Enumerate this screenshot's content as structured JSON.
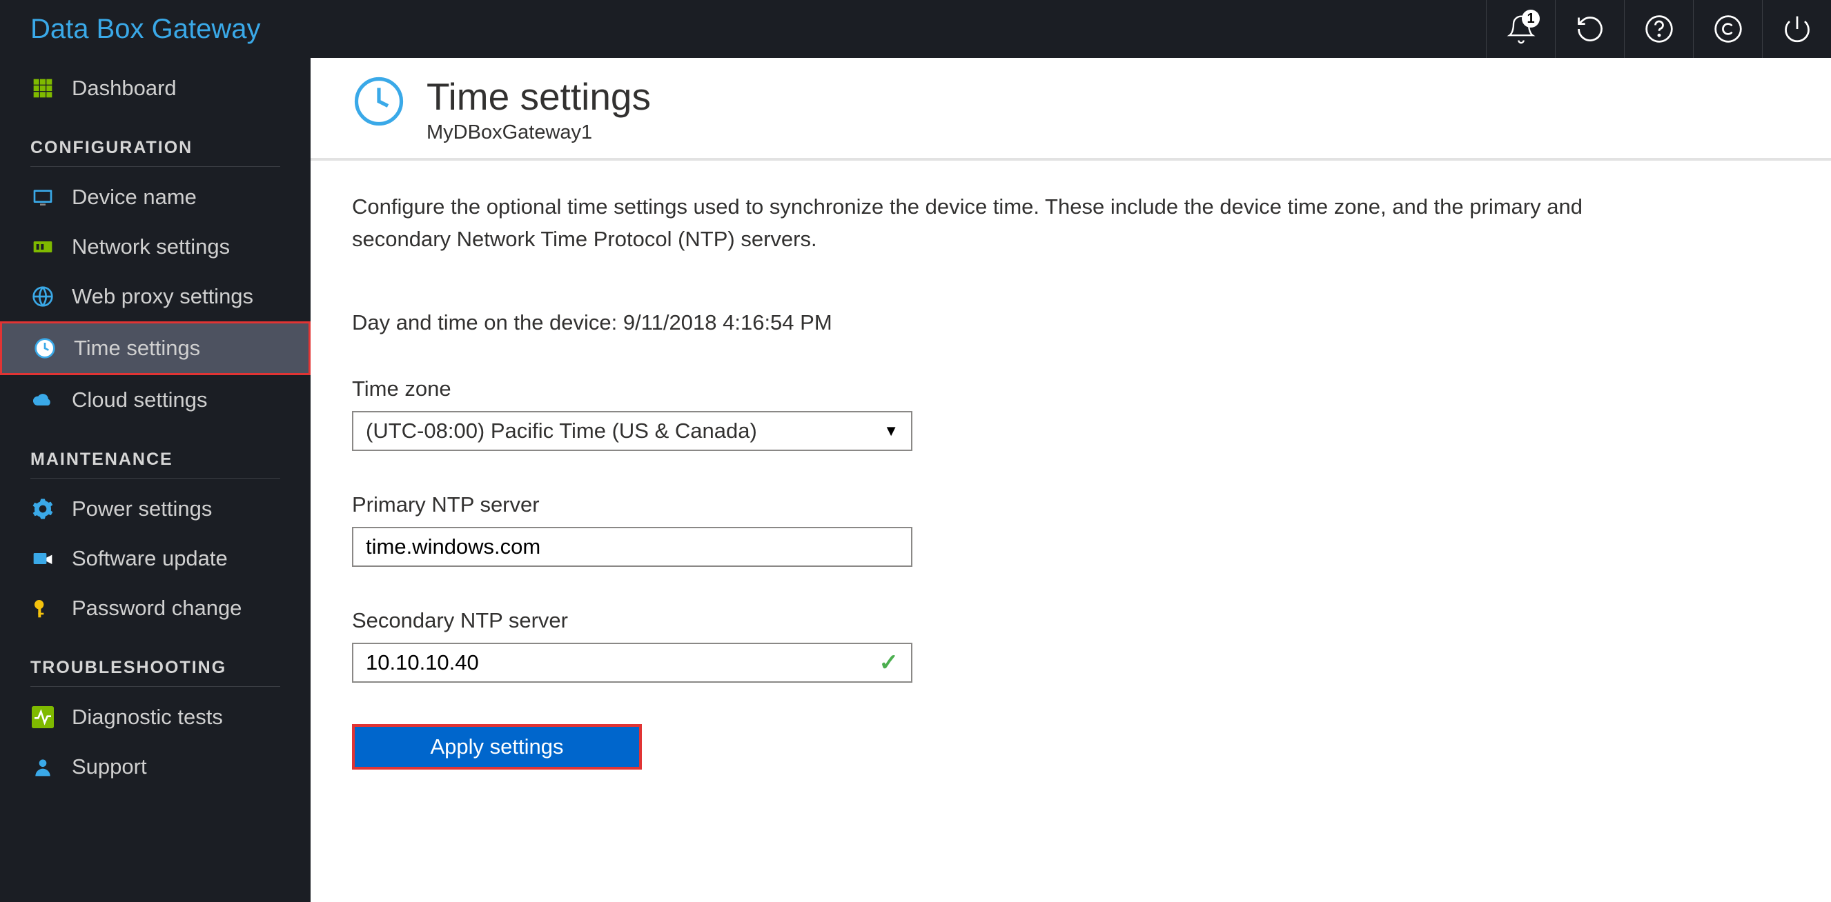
{
  "brand": "Data Box Gateway",
  "topbar": {
    "notif_count": "1"
  },
  "sidebar": {
    "dashboard_label": "Dashboard",
    "section_config": "CONFIGURATION",
    "device_name_label": "Device name",
    "network_label": "Network settings",
    "webproxy_label": "Web proxy settings",
    "time_label": "Time settings",
    "cloud_label": "Cloud settings",
    "section_maint": "MAINTENANCE",
    "power_label": "Power settings",
    "software_label": "Software update",
    "password_label": "Password change",
    "section_trouble": "TROUBLESHOOTING",
    "diag_label": "Diagnostic tests",
    "support_label": "Support"
  },
  "page": {
    "title": "Time settings",
    "subtitle": "MyDBoxGateway1",
    "description": "Configure the optional time settings used to synchronize the device time. These include the device time zone, and the primary and secondary Network Time Protocol (NTP) servers.",
    "device_time_label": "Day and time on the device: 9/11/2018 4:16:54 PM",
    "tz_label": "Time zone",
    "tz_value": "(UTC-08:00) Pacific Time (US & Canada)",
    "primary_label": "Primary NTP server",
    "primary_value": "time.windows.com",
    "secondary_label": "Secondary NTP server",
    "secondary_value": "10.10.10.40",
    "apply_label": "Apply settings"
  }
}
